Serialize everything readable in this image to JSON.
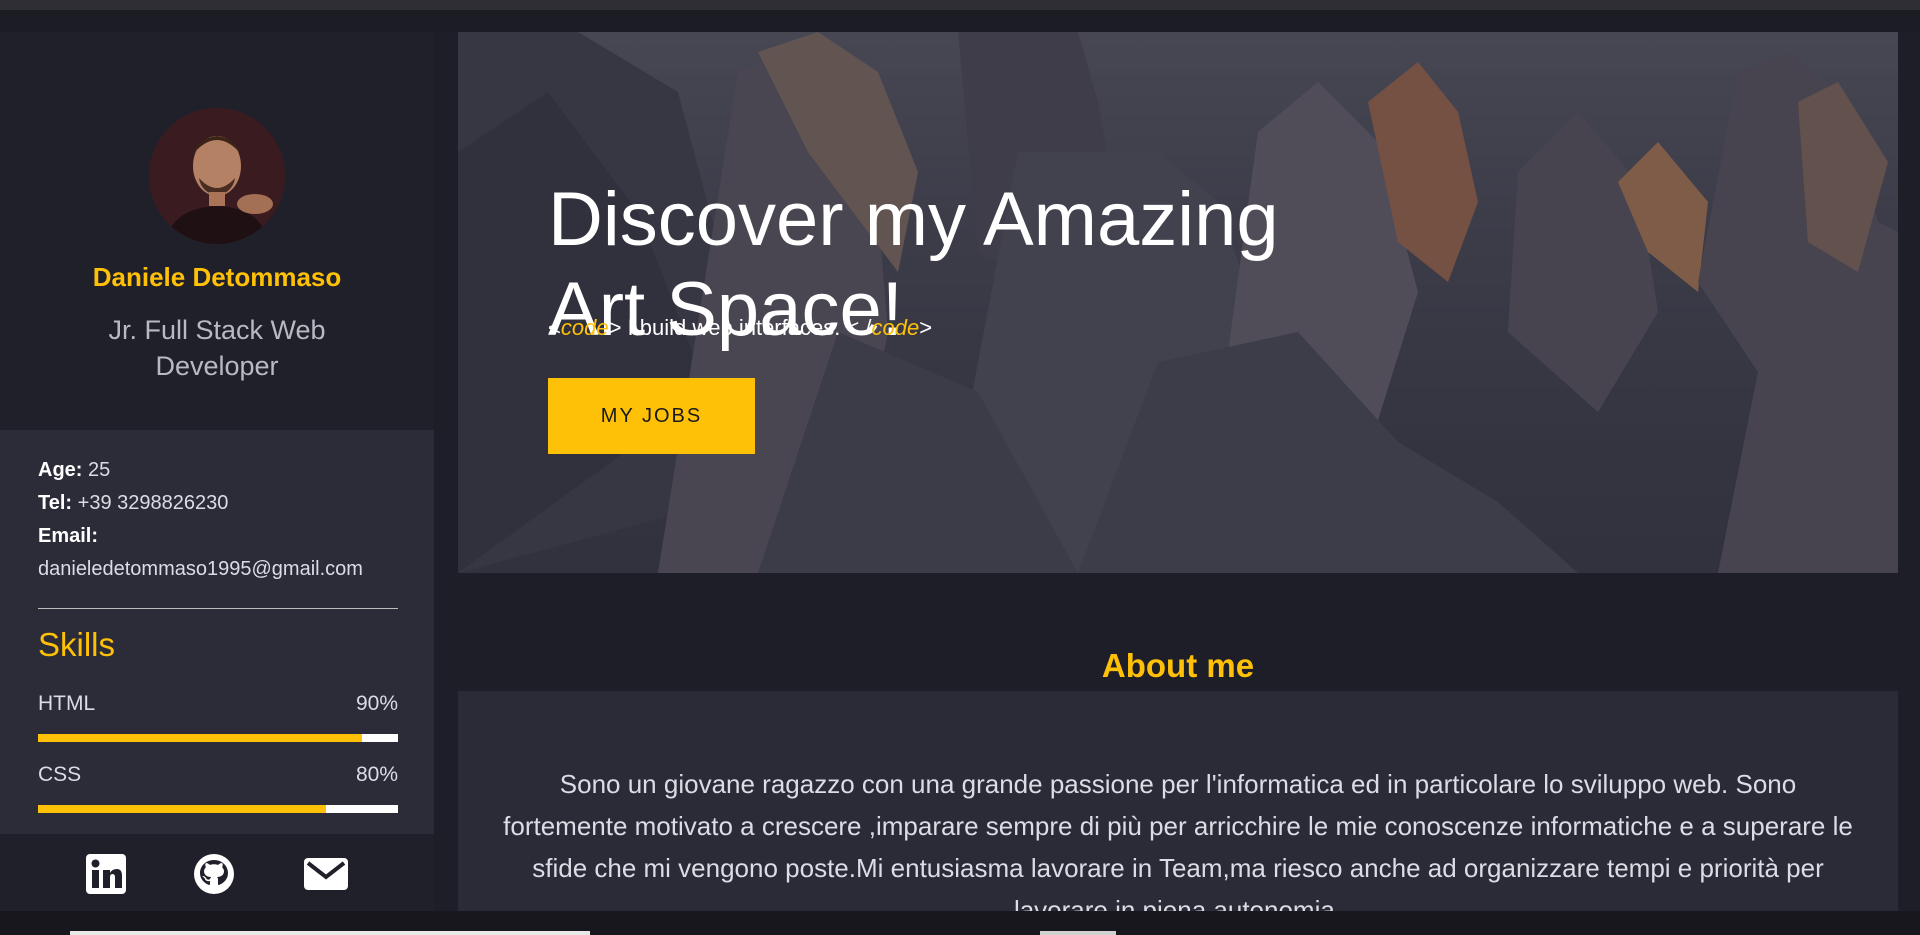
{
  "sidebar": {
    "name": "Daniele Detommaso",
    "role": "Jr. Full Stack Web Developer",
    "info": {
      "age_label": "Age:",
      "age_value": "25",
      "tel_label": "Tel:",
      "tel_value": "+39 3298826230",
      "email_label": "Email:",
      "email_value": "danieledetommaso1995@gmail.com"
    },
    "skills_title": "Skills",
    "skills": [
      {
        "name": "HTML",
        "percent_label": "90%",
        "level": 0.9
      },
      {
        "name": "CSS",
        "percent_label": "80%",
        "level": 0.8
      }
    ],
    "social": [
      "linkedin-icon",
      "github-icon",
      "email-icon"
    ]
  },
  "hero": {
    "title_line1": "Discover my Amazing",
    "title_line2": "Art Space!",
    "subtitle_open_lt": "<",
    "subtitle_code1": "code",
    "subtitle_gt": "> I build web interfaces. < /",
    "subtitle_code2": "code",
    "subtitle_close": ">",
    "button_label": "MY JOBS"
  },
  "about": {
    "title": "About me",
    "text": "Sono un giovane ragazzo con una grande passione per l'informatica ed in particolare lo sviluppo web. Sono fortemente motivato a crescere ,imparare sempre di più per arricchire le mie conoscenze informatiche e a superare le sfide che mi vengono poste.Mi entusiasma lavorare in Team,ma riesco anche ad organizzare tempi e priorità per lavorare in piena autonomia."
  },
  "colors": {
    "accent": "#ffc107",
    "background": "#1e1e28",
    "panel": "#2c2c38"
  }
}
